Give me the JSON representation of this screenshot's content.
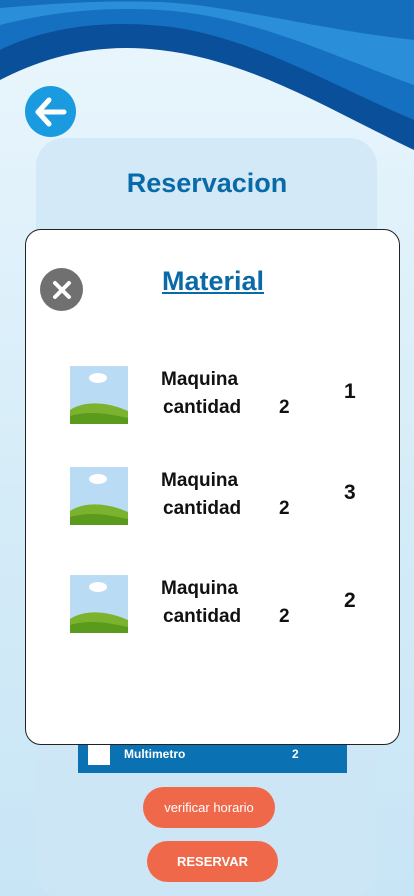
{
  "header": {
    "back_icon": "arrow-left-icon",
    "title": "Reservacion"
  },
  "list": {
    "rows": [
      {
        "name": "Multimetro",
        "quantity": "2"
      }
    ]
  },
  "buttons": {
    "verify_label": "verificar  horario",
    "reserve_label": "RESERVAR"
  },
  "modal": {
    "title": "Material",
    "close_icon": "close-x-icon",
    "items": [
      {
        "name": "Maquina",
        "quantity_label": "cantidad",
        "quantity": "2",
        "count": "1",
        "image_icon": "image-placeholder-icon"
      },
      {
        "name": "Maquina",
        "quantity_label": "cantidad",
        "quantity": "2",
        "count": "3",
        "image_icon": "image-placeholder-icon"
      },
      {
        "name": "Maquina",
        "quantity_label": "cantidad",
        "quantity": "2",
        "count": "2",
        "image_icon": "image-placeholder-icon"
      }
    ]
  },
  "colors": {
    "primary_blue": "#0a6aa8",
    "accent_orange": "#f0684a",
    "back_button": "#1a9be0"
  }
}
